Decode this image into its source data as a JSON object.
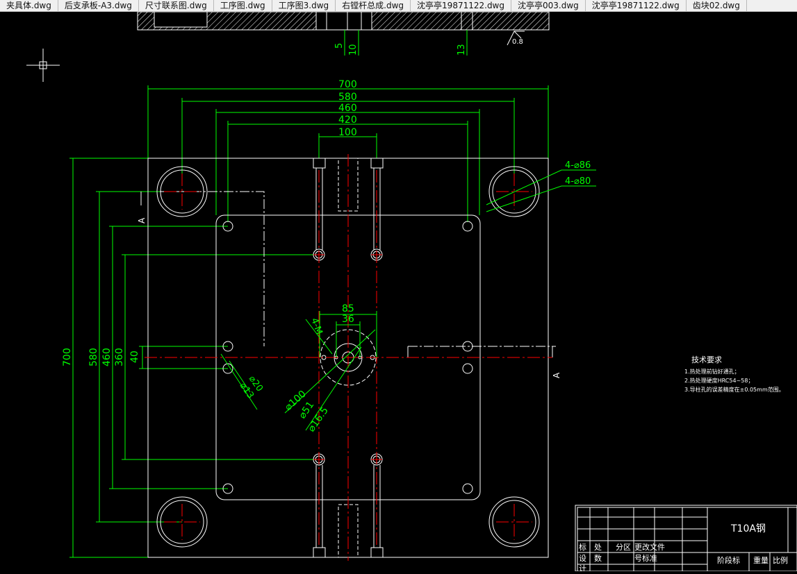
{
  "tabs": [
    {
      "label": "夹具体.dwg"
    },
    {
      "label": "后支承板-A3.dwg"
    },
    {
      "label": "尺寸联系图.dwg"
    },
    {
      "label": "工序图.dwg"
    },
    {
      "label": "工序图3.dwg"
    },
    {
      "label": "右镗杆总成.dwg"
    },
    {
      "label": "沈亭亭19871122.dwg"
    },
    {
      "label": "沈亭亭003.dwg"
    },
    {
      "label": "沈亭亭19871122.dwg"
    },
    {
      "label": "齿块02.dwg"
    }
  ],
  "drawing": {
    "top_dims": [
      "5",
      "10",
      "13"
    ],
    "width_dims": [
      "700",
      "580",
      "460",
      "420",
      "100"
    ],
    "height_dims": [
      "700",
      "580",
      "460",
      "360",
      "40"
    ],
    "hole_callouts": [
      "4-⌀86",
      "4-⌀80"
    ],
    "center_dims": [
      "85",
      "36"
    ],
    "section_labels": [
      "A",
      "A"
    ],
    "thread_label": "4-M",
    "small_bore_labels": [
      "⌀20",
      "⌀13"
    ],
    "bore_labels": [
      "⌀100",
      "⌀51",
      "⌀16.5"
    ],
    "surface_mark": "0.8",
    "tech_req": {
      "title": "技术要求",
      "items": [
        "1.热处理前钻好通孔；",
        "2.热处理硬度HRC54~58；",
        "3.导柱孔的误差精度在±0.05mm范围。"
      ]
    },
    "title_block": {
      "material": "T10A钢",
      "row1": [
        "标",
        "处",
        "分区",
        "更改文件"
      ],
      "row2": [
        "设",
        "数",
        "号标准"
      ],
      "right_labels": [
        "阶段标",
        "重量",
        "比例"
      ],
      "bottom_left": "计"
    }
  },
  "colors": {
    "background": "#000000",
    "geometry": "#ffffff",
    "dimension": "#00ff00",
    "centerline": "#ff0000"
  }
}
